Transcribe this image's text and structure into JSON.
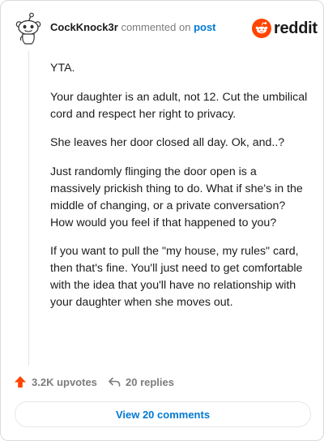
{
  "header": {
    "username": "CockKnock3r",
    "action_text": "commented on",
    "post_link": "post",
    "brand_name": "reddit"
  },
  "comment": {
    "paragraphs": [
      "YTA.",
      "Your daughter is an adult, not 12. Cut the umbilical cord and respect her right to privacy.",
      "She leaves her door closed all day. Ok, and..?",
      "Just randomly flinging the door open is a massively prickish thing to do. What if she's in the middle of changing, or a private conversation? How would you feel if that happened to you?",
      "If you want to pull the \"my house, my rules\" card, then that's fine. You'll just need to get comfortable with the idea that you'll have no relationship with your daughter when she moves out."
    ]
  },
  "stats": {
    "upvotes": "3.2K upvotes",
    "replies": "20 replies"
  },
  "view_comments_label": "View 20 comments",
  "icons": {
    "avatar": "snoo-avatar-icon",
    "brand": "reddit-logo-icon",
    "upvote": "upvote-arrow-icon",
    "reply": "reply-arrow-icon"
  },
  "colors": {
    "brand_orange": "#ff4500",
    "link_blue": "#0079d3",
    "meta_gray": "#7c7c7c"
  }
}
